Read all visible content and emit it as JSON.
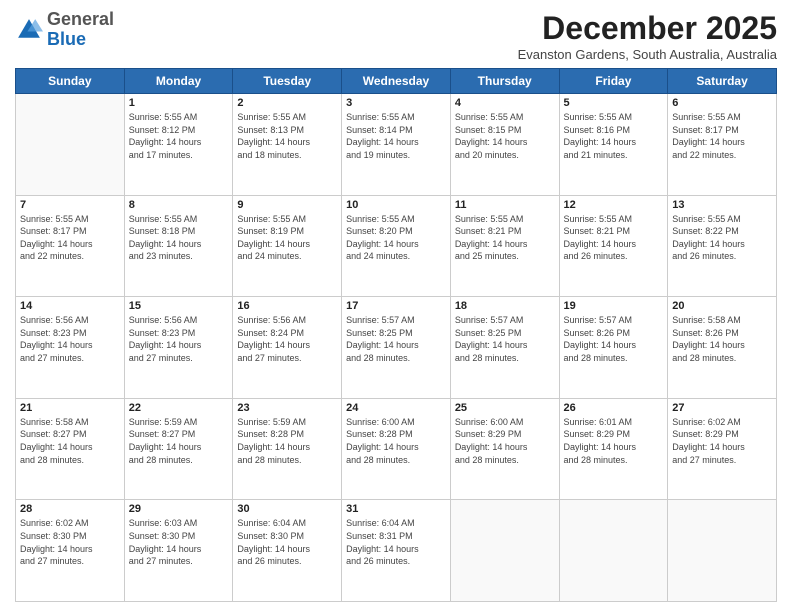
{
  "logo": {
    "general": "General",
    "blue": "Blue"
  },
  "header": {
    "month": "December 2025",
    "location": "Evanston Gardens, South Australia, Australia"
  },
  "weekdays": [
    "Sunday",
    "Monday",
    "Tuesday",
    "Wednesday",
    "Thursday",
    "Friday",
    "Saturday"
  ],
  "weeks": [
    [
      {
        "day": "",
        "info": ""
      },
      {
        "day": "1",
        "info": "Sunrise: 5:55 AM\nSunset: 8:12 PM\nDaylight: 14 hours\nand 17 minutes."
      },
      {
        "day": "2",
        "info": "Sunrise: 5:55 AM\nSunset: 8:13 PM\nDaylight: 14 hours\nand 18 minutes."
      },
      {
        "day": "3",
        "info": "Sunrise: 5:55 AM\nSunset: 8:14 PM\nDaylight: 14 hours\nand 19 minutes."
      },
      {
        "day": "4",
        "info": "Sunrise: 5:55 AM\nSunset: 8:15 PM\nDaylight: 14 hours\nand 20 minutes."
      },
      {
        "day": "5",
        "info": "Sunrise: 5:55 AM\nSunset: 8:16 PM\nDaylight: 14 hours\nand 21 minutes."
      },
      {
        "day": "6",
        "info": "Sunrise: 5:55 AM\nSunset: 8:17 PM\nDaylight: 14 hours\nand 22 minutes."
      }
    ],
    [
      {
        "day": "7",
        "info": "Sunrise: 5:55 AM\nSunset: 8:17 PM\nDaylight: 14 hours\nand 22 minutes."
      },
      {
        "day": "8",
        "info": "Sunrise: 5:55 AM\nSunset: 8:18 PM\nDaylight: 14 hours\nand 23 minutes."
      },
      {
        "day": "9",
        "info": "Sunrise: 5:55 AM\nSunset: 8:19 PM\nDaylight: 14 hours\nand 24 minutes."
      },
      {
        "day": "10",
        "info": "Sunrise: 5:55 AM\nSunset: 8:20 PM\nDaylight: 14 hours\nand 24 minutes."
      },
      {
        "day": "11",
        "info": "Sunrise: 5:55 AM\nSunset: 8:21 PM\nDaylight: 14 hours\nand 25 minutes."
      },
      {
        "day": "12",
        "info": "Sunrise: 5:55 AM\nSunset: 8:21 PM\nDaylight: 14 hours\nand 26 minutes."
      },
      {
        "day": "13",
        "info": "Sunrise: 5:55 AM\nSunset: 8:22 PM\nDaylight: 14 hours\nand 26 minutes."
      }
    ],
    [
      {
        "day": "14",
        "info": "Sunrise: 5:56 AM\nSunset: 8:23 PM\nDaylight: 14 hours\nand 27 minutes."
      },
      {
        "day": "15",
        "info": "Sunrise: 5:56 AM\nSunset: 8:23 PM\nDaylight: 14 hours\nand 27 minutes."
      },
      {
        "day": "16",
        "info": "Sunrise: 5:56 AM\nSunset: 8:24 PM\nDaylight: 14 hours\nand 27 minutes."
      },
      {
        "day": "17",
        "info": "Sunrise: 5:57 AM\nSunset: 8:25 PM\nDaylight: 14 hours\nand 28 minutes."
      },
      {
        "day": "18",
        "info": "Sunrise: 5:57 AM\nSunset: 8:25 PM\nDaylight: 14 hours\nand 28 minutes."
      },
      {
        "day": "19",
        "info": "Sunrise: 5:57 AM\nSunset: 8:26 PM\nDaylight: 14 hours\nand 28 minutes."
      },
      {
        "day": "20",
        "info": "Sunrise: 5:58 AM\nSunset: 8:26 PM\nDaylight: 14 hours\nand 28 minutes."
      }
    ],
    [
      {
        "day": "21",
        "info": "Sunrise: 5:58 AM\nSunset: 8:27 PM\nDaylight: 14 hours\nand 28 minutes."
      },
      {
        "day": "22",
        "info": "Sunrise: 5:59 AM\nSunset: 8:27 PM\nDaylight: 14 hours\nand 28 minutes."
      },
      {
        "day": "23",
        "info": "Sunrise: 5:59 AM\nSunset: 8:28 PM\nDaylight: 14 hours\nand 28 minutes."
      },
      {
        "day": "24",
        "info": "Sunrise: 6:00 AM\nSunset: 8:28 PM\nDaylight: 14 hours\nand 28 minutes."
      },
      {
        "day": "25",
        "info": "Sunrise: 6:00 AM\nSunset: 8:29 PM\nDaylight: 14 hours\nand 28 minutes."
      },
      {
        "day": "26",
        "info": "Sunrise: 6:01 AM\nSunset: 8:29 PM\nDaylight: 14 hours\nand 28 minutes."
      },
      {
        "day": "27",
        "info": "Sunrise: 6:02 AM\nSunset: 8:29 PM\nDaylight: 14 hours\nand 27 minutes."
      }
    ],
    [
      {
        "day": "28",
        "info": "Sunrise: 6:02 AM\nSunset: 8:30 PM\nDaylight: 14 hours\nand 27 minutes."
      },
      {
        "day": "29",
        "info": "Sunrise: 6:03 AM\nSunset: 8:30 PM\nDaylight: 14 hours\nand 27 minutes."
      },
      {
        "day": "30",
        "info": "Sunrise: 6:04 AM\nSunset: 8:30 PM\nDaylight: 14 hours\nand 26 minutes."
      },
      {
        "day": "31",
        "info": "Sunrise: 6:04 AM\nSunset: 8:31 PM\nDaylight: 14 hours\nand 26 minutes."
      },
      {
        "day": "",
        "info": ""
      },
      {
        "day": "",
        "info": ""
      },
      {
        "day": "",
        "info": ""
      }
    ]
  ]
}
